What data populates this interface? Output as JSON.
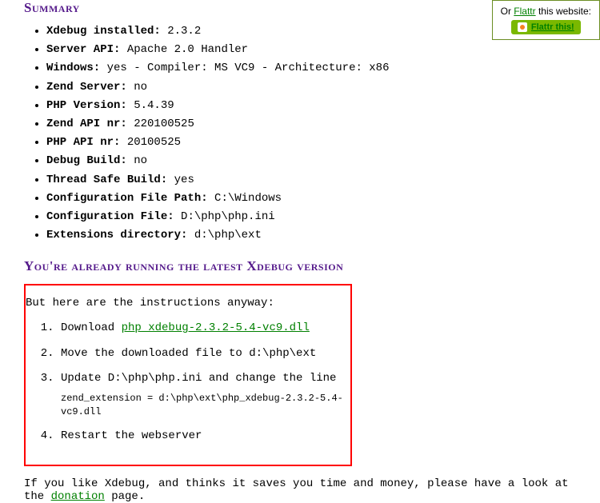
{
  "flattr": {
    "text_before": "Or ",
    "link": "Flattr",
    "text_after": " this website:",
    "button_label": "Flattr this!"
  },
  "summary": {
    "heading": "Summary",
    "items": [
      {
        "label": "Xdebug installed:",
        "value": " 2.3.2"
      },
      {
        "label": "Server API:",
        "value": " Apache 2.0 Handler"
      },
      {
        "label": "Windows:",
        "value": " yes - Compiler: MS VC9 - Architecture: x86"
      },
      {
        "label": "Zend Server:",
        "value": " no"
      },
      {
        "label": "PHP Version:",
        "value": " 5.4.39"
      },
      {
        "label": "Zend API nr:",
        "value": " 220100525"
      },
      {
        "label": "PHP API nr:",
        "value": " 20100525"
      },
      {
        "label": "Debug Build:",
        "value": " no"
      },
      {
        "label": "Thread Safe Build:",
        "value": " yes"
      },
      {
        "label": "Configuration File Path:",
        "value": " C:\\Windows"
      },
      {
        "label": "Configuration File:",
        "value": " D:\\php\\php.ini"
      },
      {
        "label": "Extensions directory:",
        "value": " d:\\php\\ext"
      }
    ]
  },
  "running": {
    "heading": "You're already running the latest Xdebug version",
    "intro": "But here are the instructions anyway:",
    "steps": {
      "s1_prefix": "Download ",
      "s1_link": "php_xdebug-2.3.2-5.4-vc9.dll",
      "s2": "Move the downloaded file to d:\\php\\ext",
      "s3_line1": "Update D:\\php\\php.ini and change the line",
      "s3_code": "zend_extension = d:\\php\\ext\\php_xdebug-2.3.2-5.4-vc9.dll",
      "s4": "Restart the webserver"
    }
  },
  "footer": {
    "before": "If you like Xdebug, and thinks it saves you time and money, please have a look at the ",
    "link": "donation",
    "after": " page."
  }
}
